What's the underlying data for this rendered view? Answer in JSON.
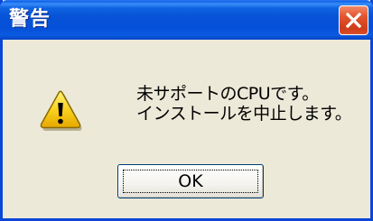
{
  "window": {
    "title": "警告",
    "close_icon": "close-icon"
  },
  "dialog": {
    "icon": "warning-icon",
    "message_line1": "未サポートのCPUです。",
    "message_line2": "インストールを中止します。",
    "ok_label": "OK"
  },
  "colors": {
    "titlebar": "#0550d8",
    "close_button": "#e3562f",
    "dialog_background": "#ece9d8",
    "warning_yellow": "#f8d21e"
  }
}
